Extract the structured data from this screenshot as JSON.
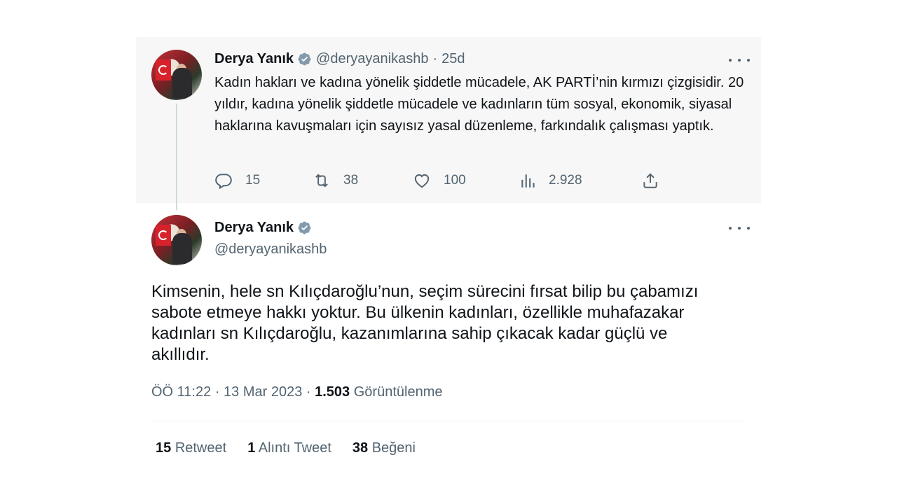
{
  "parent_tweet": {
    "author_name": "Derya Yanık",
    "handle": "@deryayanikashb",
    "separator": "·",
    "age": "25d",
    "text": "Kadın hakları ve kadına yönelik şiddetle mücadele, AK PARTİ’nin kırmızı çizgisidir. 20 yıldır, kadına yönelik şiddetle mücadele ve kadınların tüm sosyal, ekonomik, siyasal haklarına kavuşmaları için sayısız yasal düzenleme, farkındalık çalışması yaptık.",
    "actions": {
      "replies": "15",
      "retweets": "38",
      "likes": "100",
      "views": "2.928"
    }
  },
  "main_tweet": {
    "author_name": "Derya Yanık",
    "handle": "@deryayanikashb",
    "text": "Kimsenin, hele sn Kılıçdaroğlu’nun, seçim sürecini fırsat bilip bu çabamızı sabote etmeye hakkı yoktur. Bu ülkenin kadınları, özellikle muhafazakar kadınları sn Kılıçdaroğlu, kazanımlarına sahip çıkacak kadar güçlü ve akıllıdır.",
    "time": "ÖÖ 11:22",
    "sep1": "·",
    "date": "13 Mar 2023",
    "sep2": "·",
    "views_count": "1.503",
    "views_label": "Görüntülenme",
    "stats": {
      "retweet_count": "15",
      "retweet_label": "Retweet",
      "quote_count": "1",
      "quote_label": "Alıntı Tweet",
      "like_count": "38",
      "like_label": "Beğeni"
    }
  },
  "colors": {
    "verified_badge": "#829aab",
    "secondary_text": "#536471",
    "primary_text": "#0f1419",
    "parent_background": "#f7f7f7"
  },
  "icons": [
    "verified-badge-icon",
    "more-icon",
    "reply-icon",
    "retweet-icon",
    "like-icon",
    "views-icon",
    "share-icon"
  ]
}
